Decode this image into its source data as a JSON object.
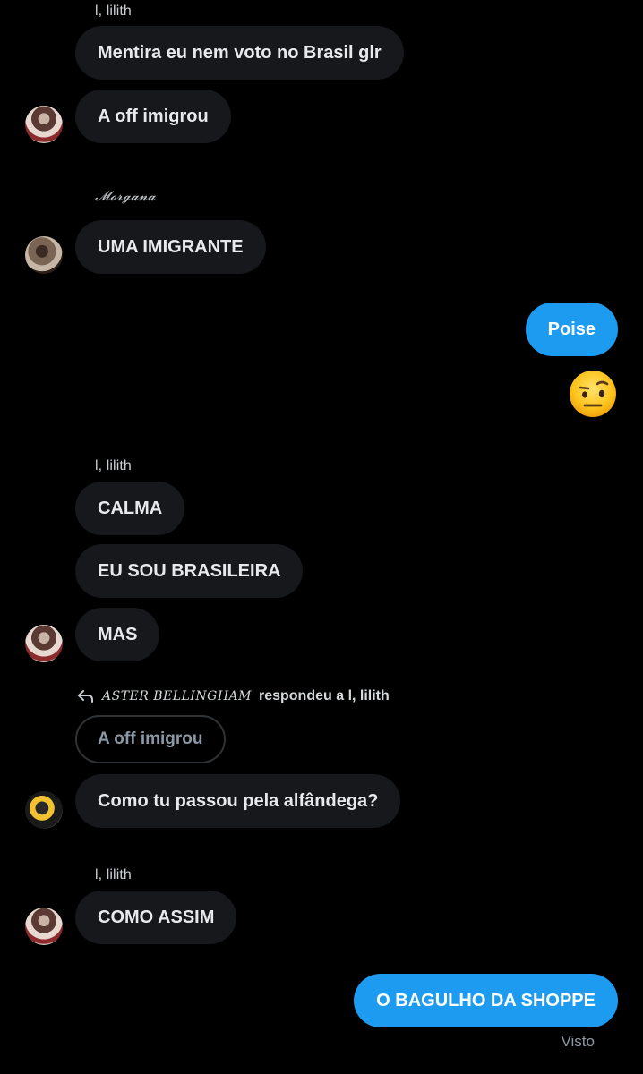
{
  "messages": {
    "m1_sender": "l, lilith",
    "m1_text": "Mentira eu nem voto no Brasil glr",
    "m2_text": "A off imigrou",
    "m3_sender": "𝓜𝓸𝓻𝓰𝓪𝓷𝓪",
    "m3_text": "UMA IMIGRANTE",
    "m4_text": "Poise",
    "m5_emoji": "face-with-raised-eyebrow-icon",
    "m6_sender": "l, lilith",
    "m6_text": "CALMA",
    "m7_text": "EU SOU BRASILEIRA",
    "m8_text": "MAS",
    "m9_reply_name": "Aster Bellingham",
    "m9_reply_verb": "respondeu a l, lilith",
    "m9_quoted": "A off imigrou",
    "m9_text": "Como tu passou pela alfândega?",
    "m10_sender": "l, lilith",
    "m10_text": "COMO ASSIM",
    "m11_text": "O BAGULHO DA SHOPPE",
    "seen_label": "Visto"
  },
  "colors": {
    "background": "#000000",
    "incoming_bubble": "#16181c",
    "outgoing_bubble": "#1d9bf0",
    "muted_text": "#8b98a5"
  }
}
